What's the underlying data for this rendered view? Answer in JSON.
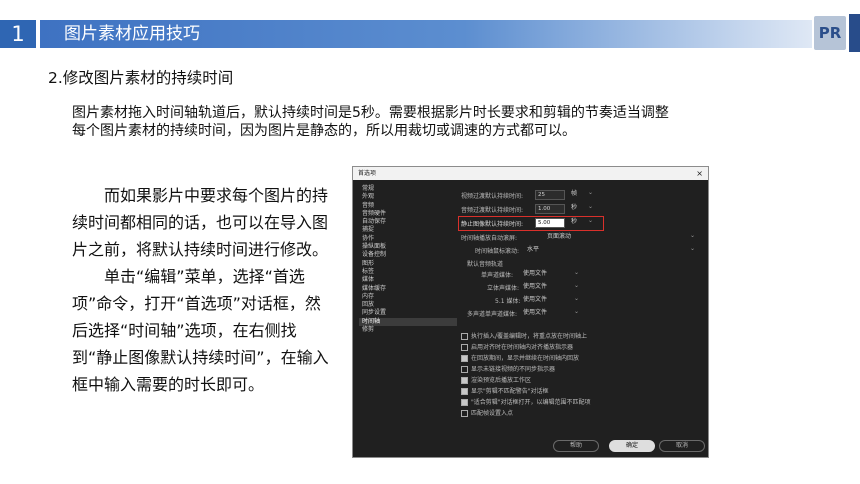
{
  "header": {
    "number": "1",
    "title": "图片素材应用技巧",
    "logo": "PR"
  },
  "subtitle": "2.修改图片素材的持续时间",
  "paragraph": [
    "图片素材拖入时间轴轨道后，默认持续时间是5秒。需要根据影片时长要求和剪辑的节奏适当调整",
    "每个图片素材的持续时间，因为图片是静态的，所以用裁切或调速的方式都可以。"
  ],
  "body": [
    "而如果影片中要求每个图片的持续时间都相同的话，也可以在导入图片之前，将默认持续时间进行修改。",
    "单击“编辑”菜单，选择“首选项”命令，打开“首选项”对话框，然后选择“时间轴”选项，在右侧找到“静止图像默认持续时间”，在输入框中输入需要的时长即可。"
  ],
  "dialog": {
    "title": "首选项",
    "close": "×",
    "sidebar": [
      "常规",
      "外观",
      "音频",
      "音频硬件",
      "自动保存",
      "捕捉",
      "协作",
      "操纵面板",
      "设备控制",
      "图形",
      "标签",
      "媒体",
      "媒体缓存",
      "内存",
      "回放",
      "同步设置",
      "时间轴",
      "修剪"
    ],
    "selected_index": 16,
    "settings": {
      "video_transition_label": "视频过渡默认持续时间:",
      "video_transition_value": "25",
      "video_transition_unit": "帧",
      "audio_transition_label": "音频过渡默认持续时间:",
      "audio_transition_value": "1.00",
      "audio_transition_unit": "秒",
      "still_label": "静止图像默认持续时间:",
      "still_value": "5.00",
      "still_unit": "秒",
      "scroll_label": "时间轴播放自动滚屏:",
      "scroll_value": "页面滚动",
      "mousewheel_label": "时间轴鼠标滚动:",
      "mousewheel_value": "水平",
      "audio_track_section": "默认音频轨道",
      "mono_label": "单声道媒体:",
      "mono_value": "使用文件",
      "stereo_label": "立体声媒体:",
      "stereo_value": "使用文件",
      "surround_label": "5.1 媒体:",
      "surround_value": "使用文件",
      "multi_label": "多声道单声道媒体:",
      "multi_value": "使用文件"
    },
    "checkboxes": [
      {
        "label": "执行插入/覆盖编辑时，将重点放在时间轴上",
        "checked": false
      },
      {
        "label": "启用对齐时在时间轴内对齐播放指示器",
        "checked": false
      },
      {
        "label": "在回放期间，显示并继续在时间轴内回放",
        "checked": true
      },
      {
        "label": "显示未链接视频的不同步指示器",
        "checked": false
      },
      {
        "label": "渲染预览后播放工作区",
        "checked": true
      },
      {
        "label": "显示\"剪辑不匹配警告\"对话框",
        "checked": true
      },
      {
        "label": "\"适合剪辑\"对话框打开，以编辑范围不匹配项",
        "checked": true
      },
      {
        "label": "匹配帧设置入点",
        "checked": false
      }
    ],
    "buttons": {
      "help": "帮助",
      "ok": "确定",
      "cancel": "取消"
    }
  },
  "colors": {
    "accent": "#2f66b3",
    "highlight": "#d9302b",
    "dialog_bg": "#202020"
  }
}
